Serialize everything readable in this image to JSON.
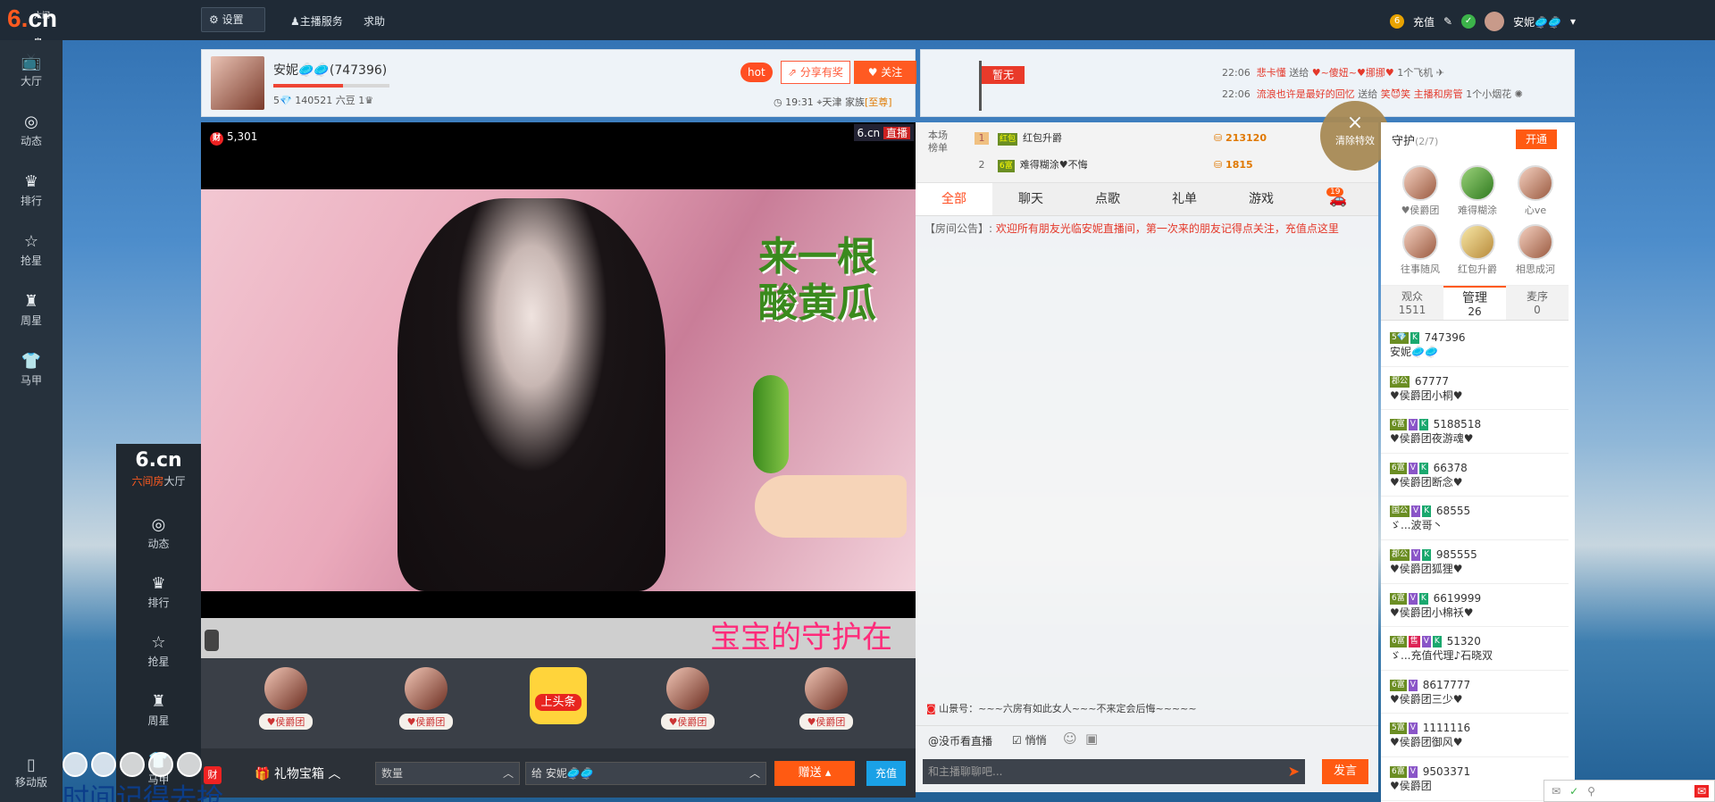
{
  "topbar": {
    "logo_main": "cn",
    "logo_six": "6.",
    "logo_sub": "六间房",
    "settings": "设置",
    "host_service": "主播服务",
    "help": "求助",
    "recharge": "充值",
    "username": "安妮🥏🥏"
  },
  "nav": [
    {
      "label": "大厅",
      "icon": "tv-icon"
    },
    {
      "label": "动态",
      "icon": "compass-icon"
    },
    {
      "label": "排行",
      "icon": "crown-icon"
    },
    {
      "label": "抢星",
      "icon": "star-icon"
    },
    {
      "label": "周星",
      "icon": "cup-icon"
    },
    {
      "label": "马甲",
      "icon": "shirt-icon"
    }
  ],
  "mobile": "移动版",
  "host": {
    "name": "安妮🥏🥏(747396)",
    "level": "5💎",
    "beans": "140521 六豆",
    "hot": "hot",
    "share": "分享有奖",
    "follow": "关注",
    "time": "19:31",
    "city": "天津",
    "family_label": "家族",
    "family_badge": "[至尊]"
  },
  "flag": "暂无",
  "giftmsgs": [
    {
      "time": "22:06",
      "from": "悲卡懂",
      "verb": "送给",
      "to": "♥~傻妞~♥挪挪♥",
      "gift": "1个飞机"
    },
    {
      "time": "22:06",
      "from": "流浪也许是最好的回忆",
      "verb": "送给",
      "to": "笑😈笑 主播和房管",
      "gift": "1个小烟花"
    }
  ],
  "video": {
    "wealth_icon": "财",
    "wealth": "5,301",
    "live_logo": "6.cn",
    "live_label": "直播",
    "slogan1": "来一根",
    "slogan2": "酸黄瓜",
    "marquee": "宝宝的守护在"
  },
  "guards": [
    {
      "tag": "♥侯爵团"
    },
    {
      "tag": "♥侯爵团"
    },
    {
      "tag": "♥侯爵团"
    },
    {
      "tag": "♥侯爵团"
    }
  ],
  "toutiao": "上头条",
  "giftbar": {
    "caishen": "财",
    "giftbox": "礼物宝箱",
    "num_placeholder": "数量",
    "to_label": "给",
    "to_name": "安妮🥏🥏",
    "send": "赠送",
    "charge": "充值"
  },
  "overlay": {
    "sub": "六间房",
    "items": [
      "大厅",
      "动态",
      "排行",
      "抢星",
      "周星",
      "马甲"
    ]
  },
  "bigtxt": "时间记得去抢",
  "rank": {
    "label": "本场榜单",
    "rows": [
      {
        "n": "1",
        "lv": "红包",
        "name": "红包升爵",
        "amt": "213120"
      },
      {
        "n": "2",
        "lv": "6富",
        "name": "难得糊涂♥不悔",
        "amt": "1815"
      }
    ]
  },
  "tabs": [
    "全部",
    "聊天",
    "点歌",
    "礼单",
    "游戏"
  ],
  "car_count": "19",
  "notice": {
    "label": "【房间公告】:",
    "text": "欢迎所有朋友光临安妮直播间，第一次来的朋友记得点关注，充值点这里"
  },
  "shanjing": "山景号：~~~六房有如此女人~~~不来定会后悔~~~~~",
  "chatopts": {
    "at": "@没币看直播",
    "private": "悄悄"
  },
  "chat_placeholder": "和主播聊聊吧...",
  "fayan": "发言",
  "clearfx": {
    "x": "×",
    "label": "清除特效"
  },
  "side": {
    "guard_title": "守护",
    "guard_count": "(2/7)",
    "open": "开通",
    "guards": [
      {
        "name": "♥侯爵团"
      },
      {
        "name": "难得糊涂"
      },
      {
        "name": "心ve"
      },
      {
        "name": "往事随风"
      },
      {
        "name": "红包升爵"
      },
      {
        "name": "相思成河"
      }
    ],
    "tabs": [
      {
        "label": "观众",
        "count": "1511"
      },
      {
        "label": "管理",
        "count": "26"
      },
      {
        "label": "麦序",
        "count": "0"
      }
    ],
    "users": [
      {
        "badges": [
          "5💎",
          "K"
        ],
        "id": "747396",
        "name": "安妮🥏🥏"
      },
      {
        "badges": [
          "郡公"
        ],
        "id": "67777",
        "name": "♥侯爵团小桐♥"
      },
      {
        "badges": [
          "6富",
          "V",
          "K"
        ],
        "id": "5188518",
        "name": "♥侯爵团夜游魂♥"
      },
      {
        "badges": [
          "6富",
          "V",
          "K"
        ],
        "id": "66378",
        "name": "♥侯爵团断念♥"
      },
      {
        "badges": [
          "国公",
          "V",
          "K"
        ],
        "id": "68555",
        "name": "ゞ...波哥丶"
      },
      {
        "badges": [
          "郡公",
          "V",
          "K"
        ],
        "id": "985555",
        "name": "♥侯爵团狐狸♥"
      },
      {
        "badges": [
          "6富",
          "V",
          "K"
        ],
        "id": "6619999",
        "name": "♥侯爵团小棉袄♥"
      },
      {
        "badges": [
          "6富",
          "售",
          "V",
          "K"
        ],
        "id": "51320",
        "name": "ゞ...充值代理♪石晓双"
      },
      {
        "badges": [
          "6富",
          "V"
        ],
        "id": "8617777",
        "name": "♥侯爵团三少♥"
      },
      {
        "badges": [
          "5富",
          "V"
        ],
        "id": "1111116",
        "name": "♥侯爵团御风♥"
      },
      {
        "badges": [
          "6富",
          "V"
        ],
        "id": "9503371",
        "name": "♥侯爵团"
      }
    ]
  },
  "colors": {
    "accent": "#ff5a12",
    "topbar": "#1f2a36",
    "sidebar": "#26313c"
  }
}
